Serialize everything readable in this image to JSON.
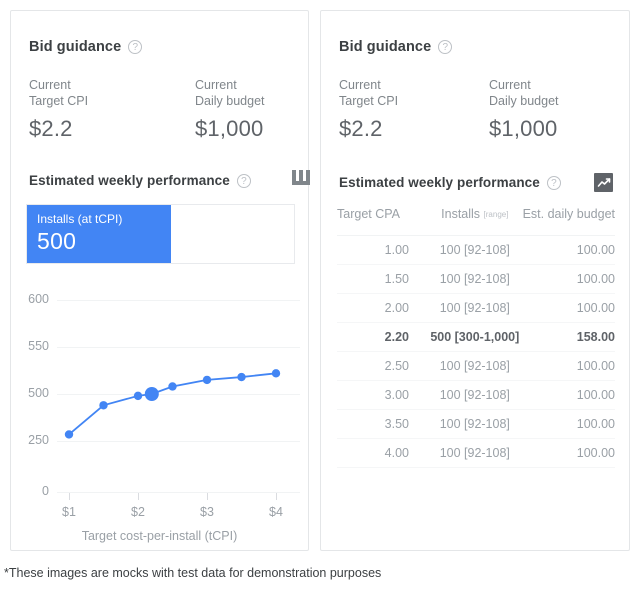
{
  "cards": {
    "left": {
      "title": "Bid guidance",
      "help_icon": "help-circle-icon",
      "metrics": [
        {
          "label_line1": "Current",
          "label_line2": "Target CPI",
          "value": "$2.2"
        },
        {
          "label_line1": "Current",
          "label_line2": "Daily budget",
          "value": "$1,000"
        }
      ],
      "section": {
        "title": "Estimated weekly performance",
        "help_icon": "help-circle-icon",
        "toggle_icon": "table-columns-icon"
      },
      "tile": {
        "label": "Installs (at tCPI)",
        "value": "500",
        "color": "#4285f4"
      }
    },
    "right": {
      "title": "Bid guidance",
      "help_icon": "help-circle-icon",
      "metrics": [
        {
          "label_line1": "Current",
          "label_line2": "Target CPI",
          "value": "$2.2"
        },
        {
          "label_line1": "Current",
          "label_line2": "Daily budget",
          "value": "$1,000"
        }
      ],
      "section": {
        "title": "Estimated weekly performance",
        "help_icon": "help-circle-icon",
        "toggle_icon": "line-chart-icon"
      },
      "table": {
        "headers": [
          "Target CPA",
          "Installs",
          "Est. daily budget"
        ],
        "header_range_note": "[range]",
        "rows": [
          {
            "target_cpa": "1.00",
            "installs": "100 [92-108]",
            "budget": "100.00",
            "highlight": false
          },
          {
            "target_cpa": "1.50",
            "installs": "100 [92-108]",
            "budget": "100.00",
            "highlight": false
          },
          {
            "target_cpa": "2.00",
            "installs": "100 [92-108]",
            "budget": "100.00",
            "highlight": false
          },
          {
            "target_cpa": "2.20",
            "installs": "500 [300-1,000]",
            "budget": "158.00",
            "highlight": true
          },
          {
            "target_cpa": "2.50",
            "installs": "100 [92-108]",
            "budget": "100.00",
            "highlight": false
          },
          {
            "target_cpa": "3.00",
            "installs": "100 [92-108]",
            "budget": "100.00",
            "highlight": false
          },
          {
            "target_cpa": "3.50",
            "installs": "100 [92-108]",
            "budget": "100.00",
            "highlight": false
          },
          {
            "target_cpa": "4.00",
            "installs": "100 [92-108]",
            "budget": "100.00",
            "highlight": false
          }
        ]
      }
    }
  },
  "footnote": "*These images are mocks with test data for demonstration purposes",
  "colors": {
    "accent": "#4285f4",
    "text_primary": "#3c4043",
    "text_secondary": "#5f6368",
    "text_muted": "#9aa0a6",
    "grid": "#f1f3f4",
    "card_border": "#e4e6e8"
  },
  "chart_data": {
    "type": "line",
    "title": "",
    "xlabel": "Target cost-per-install (tCPI)",
    "ylabel": "",
    "x": [
      1.0,
      1.5,
      2.0,
      2.2,
      2.5,
      3.0,
      3.5,
      4.0
    ],
    "x_tick_labels": [
      "$1",
      "$2",
      "$3",
      "$4"
    ],
    "x_tick_values": [
      1,
      2,
      3,
      4
    ],
    "y_tick_labels": [
      "600",
      "550",
      "500",
      "250",
      "0"
    ],
    "y_tick_values": [
      600,
      550,
      500,
      250,
      0
    ],
    "values": [
      285,
      440,
      490,
      500,
      508,
      515,
      518,
      522
    ],
    "highlight_index": 3,
    "highlight_value": 500,
    "series_color": "#4285f4",
    "grid": true,
    "legend": "none",
    "note": "Y axis tick labels are unevenly valued but evenly spaced in the mock"
  }
}
